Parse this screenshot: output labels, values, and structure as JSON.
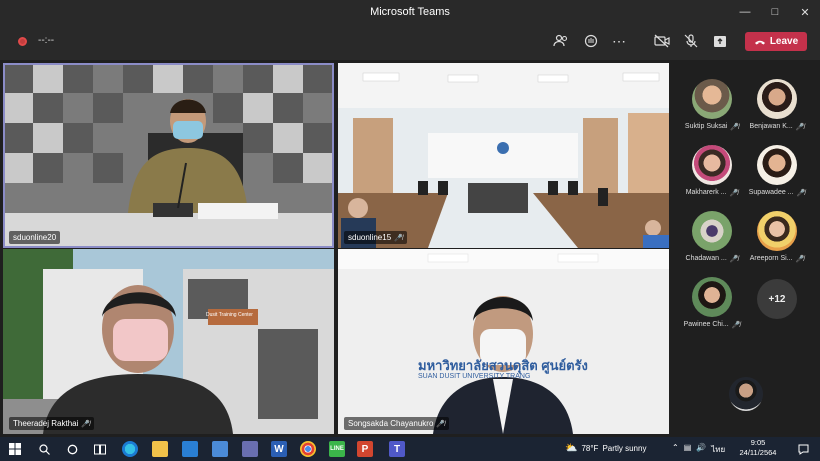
{
  "window": {
    "title": "Microsoft Teams"
  },
  "toolbar": {
    "timer": "--:--",
    "leave_label": "Leave"
  },
  "tiles": [
    {
      "name": "sduonline20",
      "mic_muted": false,
      "active": true
    },
    {
      "name": "sduonline15",
      "mic_muted": true,
      "active": false
    },
    {
      "name": "Theeradej Rakthai",
      "mic_muted": true,
      "active": false
    },
    {
      "name": "Songsakda Chayanukro",
      "mic_muted": true,
      "active": false
    }
  ],
  "scene_text": {
    "banner_top": "มหาวิทยาลัยสวนดุสิต ศูนย์ตรัง",
    "banner_sub": "SUAN DUSIT UNIVERSITY TRANG",
    "bus_sign": "Dusit Training Center"
  },
  "roster": [
    {
      "name": "Suktip Suksai"
    },
    {
      "name": "Benjawan K..."
    },
    {
      "name": "Makharerk ..."
    },
    {
      "name": "Supawadee ..."
    },
    {
      "name": "Chadawan ..."
    },
    {
      "name": "Areeporn Si..."
    },
    {
      "name": "Pawinee Chi..."
    }
  ],
  "roster_more": "+12",
  "taskbar": {
    "weather_temp": "78°F",
    "weather_text": "Partly sunny",
    "language": "ไทย",
    "time": "9:05",
    "date": "24/11/2564"
  }
}
